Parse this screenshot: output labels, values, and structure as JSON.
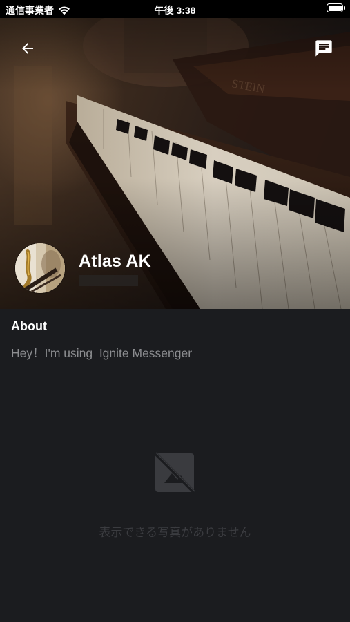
{
  "status_bar": {
    "carrier": "通信事業者",
    "time": "午後 3:38",
    "icons": [
      "wifi-icon",
      "battery-icon"
    ]
  },
  "header": {
    "back_icon": "arrow-left-icon",
    "chat_icon": "message-icon"
  },
  "profile": {
    "name": "Atlas AK"
  },
  "about": {
    "heading": "About",
    "text": "Hey！I'm using  Ignite Messenger"
  },
  "photos": {
    "empty_icon": "no-image-icon",
    "empty_text": "表示できる写真がありません"
  },
  "colors": {
    "background": "#1b1c1f",
    "muted_text": "#8c8d90",
    "empty_text": "#3b3c40"
  }
}
